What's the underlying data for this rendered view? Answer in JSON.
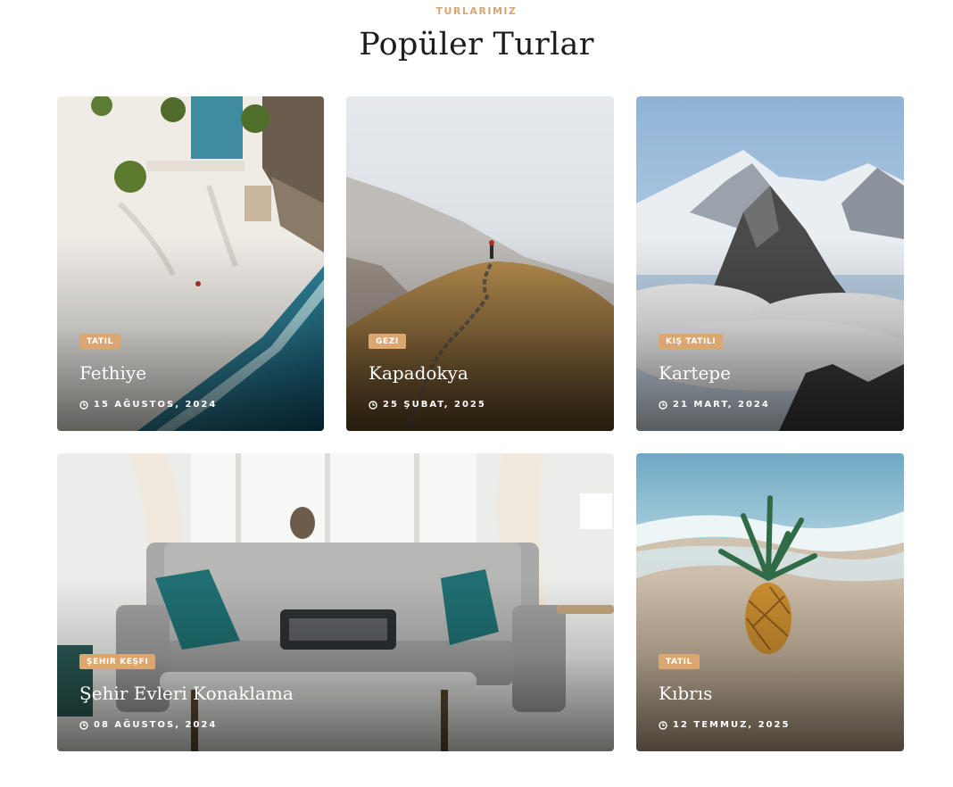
{
  "header": {
    "eyebrow": "TURLARIMIZ",
    "title": "Popüler Turlar"
  },
  "cards": [
    {
      "category": "TATIL",
      "title": "Fethiye",
      "date": "15 AĞUSTOS, 2024",
      "image": "aerial-beach-resort-photo"
    },
    {
      "category": "GEZI",
      "title": "Kapadokya",
      "date": "25 ŞUBAT, 2025",
      "image": "hiker-on-hill-photo"
    },
    {
      "category": "KIŞ TATILI",
      "title": "Kartepe",
      "date": "21 MART, 2024",
      "image": "snowy-mountains-photo"
    },
    {
      "category": "ŞEHIR KEŞFI",
      "title": "Şehir Evleri Konaklama",
      "date": "08 AĞUSTOS, 2024",
      "image": "living-room-sofa-photo"
    },
    {
      "category": "TATIL",
      "title": "Kıbrıs",
      "date": "12 TEMMUZ, 2025",
      "image": "pineapple-on-beach-photo"
    }
  ],
  "icons": {
    "date": "clock-icon"
  },
  "colors": {
    "accent": "#dba66f",
    "eyebrow": "#d9a574",
    "title": "#1c1c1c"
  }
}
